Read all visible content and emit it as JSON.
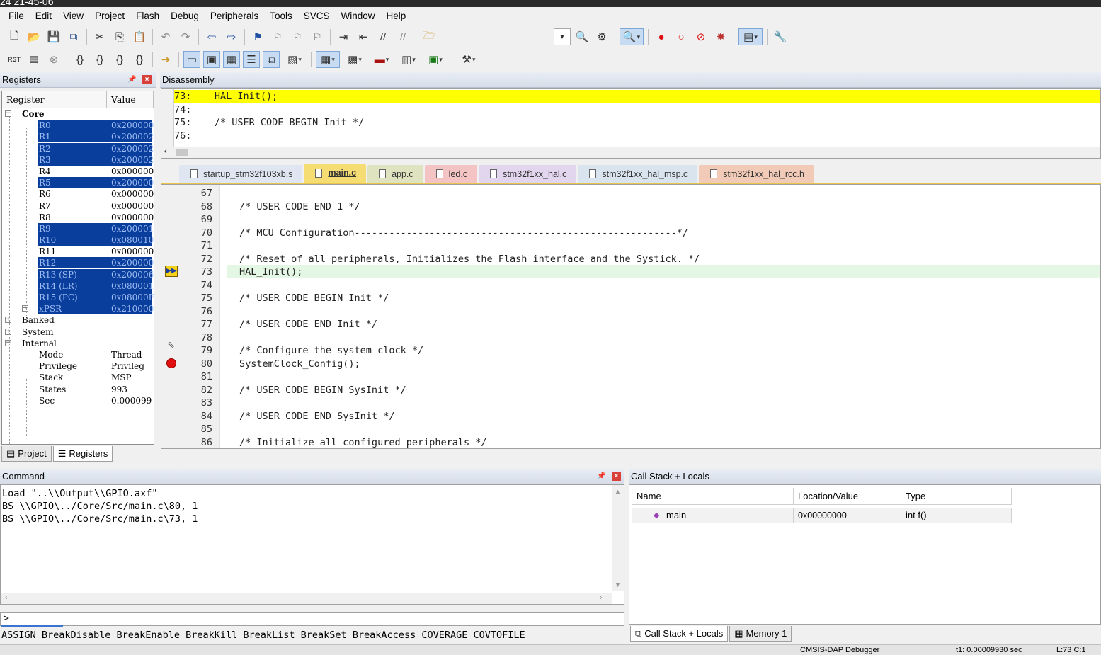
{
  "window": {
    "title": "24 21-45-06"
  },
  "menu": [
    "File",
    "Edit",
    "View",
    "Project",
    "Flash",
    "Debug",
    "Peripherals",
    "Tools",
    "SVCS",
    "Window",
    "Help"
  ],
  "registers": {
    "title": "Registers",
    "col_register": "Register",
    "col_value": "Value",
    "core_label": "Core",
    "rows": [
      {
        "name": "R0",
        "value": "0x200000",
        "selected": true
      },
      {
        "name": "R1",
        "value": "0x200002",
        "selected": true
      },
      {
        "name": "R2",
        "value": "0x200002",
        "selected": true
      },
      {
        "name": "R3",
        "value": "0x200002",
        "selected": true
      },
      {
        "name": "R4",
        "value": "0x000000",
        "selected": false
      },
      {
        "name": "R5",
        "value": "0x200000",
        "selected": true
      },
      {
        "name": "R6",
        "value": "0x000000",
        "selected": false
      },
      {
        "name": "R7",
        "value": "0x000000",
        "selected": false
      },
      {
        "name": "R8",
        "value": "0x000000",
        "selected": false
      },
      {
        "name": "R9",
        "value": "0x200001",
        "selected": true
      },
      {
        "name": "R10",
        "value": "0x080010",
        "selected": true
      },
      {
        "name": "R11",
        "value": "0x000000",
        "selected": false
      },
      {
        "name": "R12",
        "value": "0x200000",
        "selected": true
      },
      {
        "name": "R13 (SP)",
        "value": "0x200006",
        "selected": true
      },
      {
        "name": "R14 (LR)",
        "value": "0x080001",
        "selected": true
      },
      {
        "name": "R15 (PC)",
        "value": "0x08000F",
        "selected": true
      },
      {
        "name": "xPSR",
        "value": "0x210000",
        "selected": true
      }
    ],
    "banked_label": "Banked",
    "system_label": "System",
    "internal_label": "Internal",
    "internal_rows": [
      {
        "name": "Mode",
        "value": "Thread"
      },
      {
        "name": "Privilege",
        "value": "Privileg"
      },
      {
        "name": "Stack",
        "value": "MSP"
      },
      {
        "name": "States",
        "value": "993"
      },
      {
        "name": "Sec",
        "value": "0.000099"
      }
    ],
    "tabs": [
      "Project",
      "Registers"
    ]
  },
  "disassembly": {
    "title": "Disassembly",
    "lines": [
      "73:    HAL_Init();",
      "74: ",
      "75:    /* USER CODE BEGIN Init */",
      "76: "
    ]
  },
  "file_tabs": [
    {
      "label": "startup_stm32f103xb.s",
      "color": "#dfe6f1"
    },
    {
      "label": "main.c",
      "color": "#f6dd73",
      "active": true
    },
    {
      "label": "app.c",
      "color": "#e0e3c0"
    },
    {
      "label": "led.c",
      "color": "#f4c4c4"
    },
    {
      "label": "stm32f1xx_hal.c",
      "color": "#e2d6ee"
    },
    {
      "label": "stm32f1xx_hal_msp.c",
      "color": "#d9e4ef"
    },
    {
      "label": "stm32f1xx_hal_rcc.h",
      "color": "#f2cbb8"
    }
  ],
  "editor": {
    "line_numbers": [
      "67",
      "68",
      "69",
      "70",
      "71",
      "72",
      "73",
      "74",
      "75",
      "76",
      "77",
      "78",
      "79",
      "80",
      "81",
      "82",
      "83",
      "84",
      "85",
      "86"
    ],
    "lines": [
      "",
      "/* USER CODE END 1 */",
      "",
      "/* MCU Configuration--------------------------------------------------------*/",
      "",
      "/* Reset of all peripherals, Initializes the Flash interface and the Systick. */",
      "HAL_Init();",
      "",
      "/* USER CODE BEGIN Init */",
      "",
      "/* USER CODE END Init */",
      "",
      "/* Configure the system clock */",
      "SystemClock_Config();",
      "",
      "/* USER CODE BEGIN SysInit */",
      "",
      "/* USER CODE END SysInit */",
      "",
      "/* Initialize all configured peripherals */"
    ]
  },
  "command": {
    "title": "Command",
    "lines": [
      "Load \"..\\\\Output\\\\GPIO.axf\"",
      "BS \\\\GPIO\\../Core/Src/main.c\\80, 1",
      "BS \\\\GPIO\\../Core/Src/main.c\\73, 1"
    ],
    "prompt": ">",
    "help": "ASSIGN BreakDisable BreakEnable BreakKill BreakList BreakSet BreakAccess COVERAGE COVTOFILE"
  },
  "callstack": {
    "title": "Call Stack + Locals",
    "col_name": "Name",
    "col_location": "Location/Value",
    "col_type": "Type",
    "row": {
      "name": "main",
      "location": "0x00000000",
      "type": "int f()"
    },
    "tabs": [
      "Call Stack + Locals",
      "Memory 1"
    ]
  },
  "status": {
    "debugger": "CMSIS-DAP Debugger",
    "time": "t1: 0.00009930 sec",
    "pos": "L:73 C:1"
  }
}
